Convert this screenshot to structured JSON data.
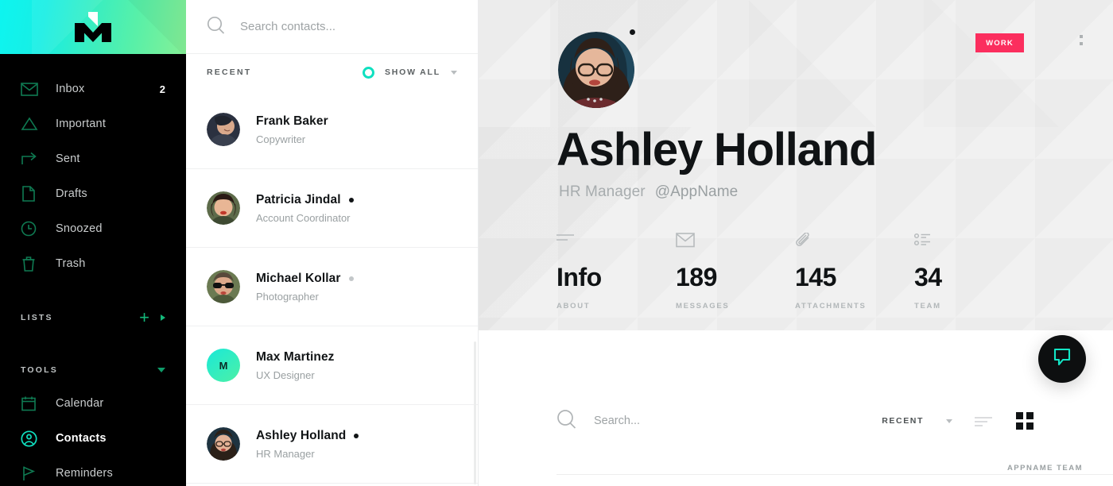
{
  "brand": {
    "logo_name": "m-logo",
    "gradient_from": "#0df5f0",
    "gradient_to": "#86f096"
  },
  "colors": {
    "accent_teal": "#10e0c0",
    "accent_green": "#14b87a",
    "badge_pink": "#fb2e5e",
    "sidebar_bg": "#000000",
    "hero_bg": "#f1f1f1"
  },
  "sidebar": {
    "items": [
      {
        "icon": "envelope-icon",
        "label": "Inbox",
        "badge": "2"
      },
      {
        "icon": "triangle-icon",
        "label": "Important",
        "badge": ""
      },
      {
        "icon": "arrow-forward-icon",
        "label": "Sent",
        "badge": ""
      },
      {
        "icon": "file-icon",
        "label": "Drafts",
        "badge": ""
      },
      {
        "icon": "clock-icon",
        "label": "Snoozed",
        "badge": ""
      },
      {
        "icon": "trash-icon",
        "label": "Trash",
        "badge": ""
      }
    ],
    "lists_section": {
      "title": "LISTS",
      "add_icon": "plus-icon",
      "expand_icon": "caret-right-icon"
    },
    "tools_section": {
      "title": "TOOLS",
      "collapse_icon": "caret-down-icon",
      "items": [
        {
          "icon": "calendar-icon",
          "label": "Calendar",
          "active": false
        },
        {
          "icon": "user-circle-icon",
          "label": "Contacts",
          "active": true
        },
        {
          "icon": "flag-icon",
          "label": "Reminders",
          "active": false
        }
      ]
    }
  },
  "contact_list": {
    "search": {
      "placeholder": "Search contacts...",
      "value": "",
      "icon": "search-icon"
    },
    "header": {
      "title": "RECENT",
      "status_ring": "ring-icon",
      "filter_label": "SHOW ALL",
      "filter_caret": "caret-down-icon"
    },
    "contacts": [
      {
        "name": "Frank Baker",
        "role": "Copywriter",
        "status": "none",
        "avatar_type": "photo",
        "initial": ""
      },
      {
        "name": "Patricia Jindal",
        "role": "Account Coordinator",
        "status": "on",
        "avatar_type": "photo",
        "initial": ""
      },
      {
        "name": "Michael Kollar",
        "role": "Photographer",
        "status": "off",
        "avatar_type": "photo",
        "initial": ""
      },
      {
        "name": "Max Martinez",
        "role": "UX Designer",
        "status": "none",
        "avatar_type": "initial",
        "initial": "M"
      },
      {
        "name": "Ashley Holland",
        "role": "HR Manager",
        "status": "on",
        "avatar_type": "photo",
        "initial": ""
      }
    ]
  },
  "profile": {
    "avatar_name": "profile-avatar",
    "status": "online",
    "name": "Ashley Holland",
    "role": "HR Manager",
    "handle": "@AppName",
    "badge": "WORK",
    "menu_icon": "kebab-menu-icon",
    "stats": [
      {
        "icon": "lines-icon",
        "value": "Info",
        "label": "ABOUT"
      },
      {
        "icon": "envelope-icon",
        "value": "189",
        "label": "MESSAGES"
      },
      {
        "icon": "paperclip-icon",
        "value": "145",
        "label": "ATTACHMENTS"
      },
      {
        "icon": "list-bullet-icon",
        "value": "34",
        "label": "TEAM"
      }
    ]
  },
  "bottom_bar": {
    "search": {
      "placeholder": "Search...",
      "value": "",
      "icon": "search-icon"
    },
    "sort_label": "RECENT",
    "sort_caret": "caret-down-icon",
    "view_list_icon": "list-view-icon",
    "view_grid_icon": "grid-view-icon",
    "footer_team": "APPNAME TEAM"
  },
  "fab": {
    "icon": "chat-bubble-icon",
    "label": ""
  }
}
